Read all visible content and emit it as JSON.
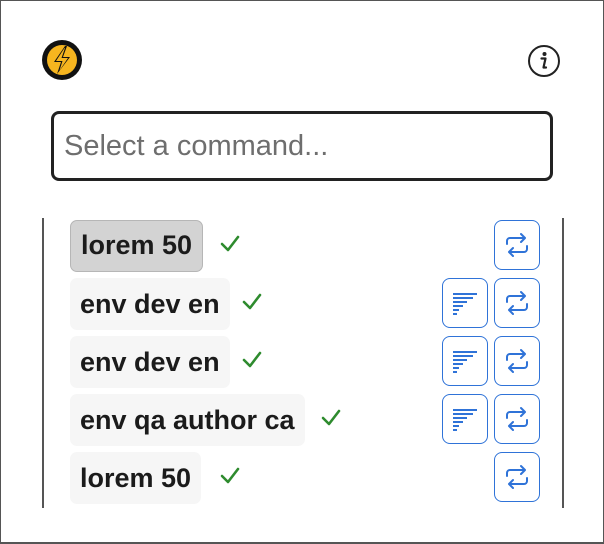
{
  "header": {
    "logo_icon": "lightning-bolt-logo",
    "info_icon": "info-icon"
  },
  "search": {
    "placeholder": "Select a command..."
  },
  "commands": [
    {
      "label": "lorem 50",
      "status": "success",
      "active": true,
      "has_doc": false
    },
    {
      "label": "env dev en",
      "status": "success",
      "active": false,
      "has_doc": true
    },
    {
      "label": "env dev en",
      "status": "success",
      "active": false,
      "has_doc": true
    },
    {
      "label": "env qa author ca",
      "status": "success",
      "active": false,
      "has_doc": true
    },
    {
      "label": "lorem 50",
      "status": "success",
      "active": false,
      "has_doc": false
    }
  ],
  "colors": {
    "accent": "#2f73d8",
    "success": "#2e8b2e",
    "logo_bg": "#111111",
    "logo_bolt": "#f6b51f"
  }
}
